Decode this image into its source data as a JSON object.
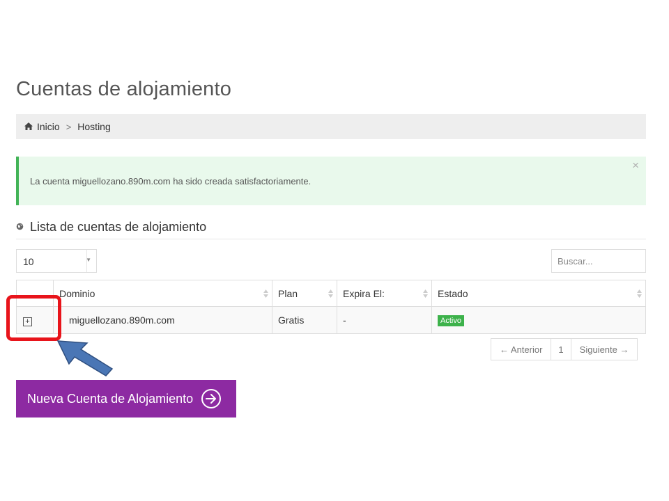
{
  "page": {
    "title": "Cuentas de alojamiento"
  },
  "breadcrumb": {
    "home_label": "Inicio",
    "separator": ">",
    "current": "Hosting"
  },
  "alert": {
    "message": "La cuenta miguellozano.890m.com ha sido creada satisfactoriamente.",
    "close_symbol": "×",
    "border_color": "#41b356"
  },
  "section": {
    "title": "Lista de cuentas de alojamiento",
    "icon": "globe-icon"
  },
  "controls": {
    "page_length": "10",
    "search_placeholder": "Buscar..."
  },
  "table": {
    "columns": [
      "",
      "Dominio",
      "Plan",
      "Expira El:",
      "Estado"
    ],
    "rows": [
      {
        "expand": "+",
        "domain": "miguellozano.890m.com",
        "plan": "Gratis",
        "expires": "-",
        "status": "Activo"
      }
    ]
  },
  "pagination": {
    "prev": "← Anterior",
    "page": "1",
    "next": "Siguiente →"
  },
  "cta": {
    "label": "Nueva Cuenta de Alojamiento",
    "icon": "arrow-circle-right-icon",
    "color": "#8d2aa2"
  },
  "annotations": {
    "highlight_color": "#e8141b",
    "arrow_color": "#4a76b5"
  }
}
